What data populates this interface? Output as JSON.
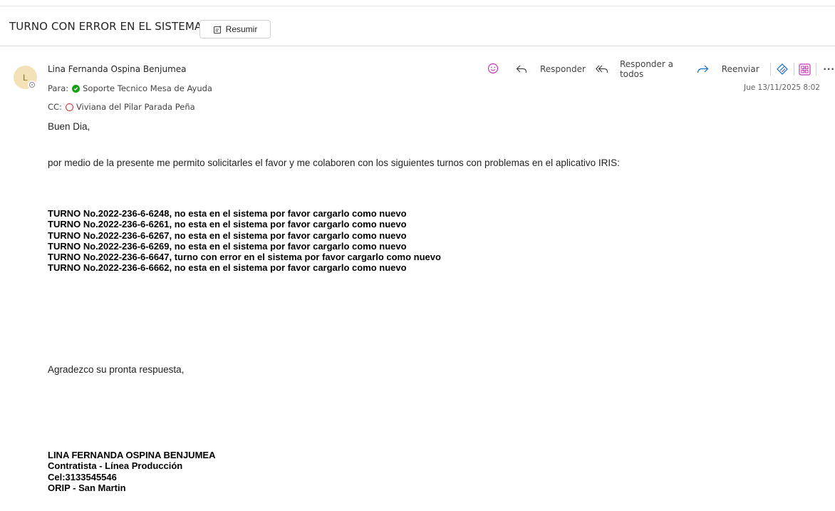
{
  "email": {
    "subject": "TURNO CON ERROR EN EL SISTEMA",
    "summarize_label": "Resumir",
    "avatar_initial": "L",
    "sender_name": "Lina Fernanda Ospina Benjumea",
    "to_label": "Para:",
    "to_name": "Soporte Tecnico Mesa de Ayuda",
    "cc_label": "CC:",
    "cc_name": "Viviana del Pilar Parada Peña",
    "date": "Jue 13/11/2025 8:02"
  },
  "actions": {
    "reply": "Responder",
    "reply_all": "Responder a todos",
    "forward": "Reenviar",
    "more": "···"
  },
  "icons": [
    "emoji-icon",
    "reply-icon",
    "reply-all-icon",
    "forward-icon",
    "loop-icon",
    "apps-icon",
    "more-icon",
    "summarize-icon"
  ],
  "colors": {
    "presence_green": "#13a10e",
    "presence_red": "#d13438",
    "emoji": "#c239b3",
    "forward": "#0f6cbd",
    "avatar_bg": "#f3e2b7"
  },
  "body": {
    "greeting": "Buen Dia,",
    "intro": "por medio de la presente me permito solicitarles el favor y me colaboren con los siguientes turnos con problemas en el aplicativo IRIS:",
    "turnos": [
      "TURNO No.2022-236-6-6248, no esta en el sistema por favor cargarlo como nuevo",
      "TURNO No.2022-236-6-6261, no esta en el sistema por favor cargarlo como nuevo",
      "TURNO No.2022-236-6-6267, no esta en el sistema por favor cargarlo como nuevo",
      "TURNO No.2022-236-6-6269, no esta en el sistema por favor cargarlo como nuevo",
      "TURNO No.2022-236-6-6647, turno con error en el sistema por favor cargarlo como nuevo",
      "TURNO No.2022-236-6-6662, no esta en el sistema por favor cargarlo como nuevo"
    ],
    "closing": "Agradezco su pronta respuesta,",
    "signature": [
      "LINA FERNANDA OSPINA BENJUMEA",
      "Contratista - Línea Producción",
      "Cel:3133545546",
      "ORIP - San Martin"
    ]
  }
}
